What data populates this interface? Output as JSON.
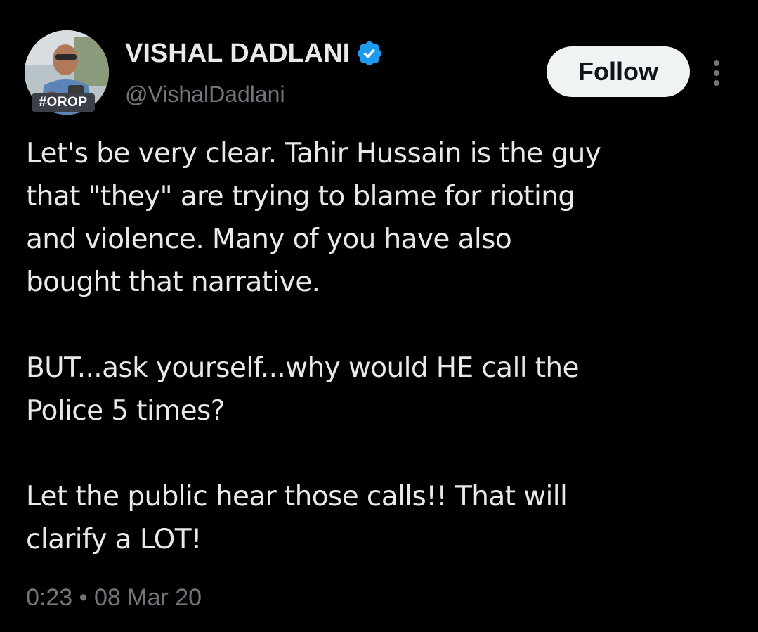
{
  "author": {
    "display_name": "VISHAL DADLANI",
    "handle": "@VishalDadlani",
    "verified": true,
    "avatar_badge": "#OROP"
  },
  "actions": {
    "follow_label": "Follow",
    "more_icon": "more-vertical-icon"
  },
  "tweet": {
    "paragraphs": [
      "Let's be very clear. Tahir Hussain is the guy\nthat \"they\" are trying to blame for rioting\nand violence. Many of you have also\nbought that narrative.",
      "BUT...ask yourself...why would HE call the\nPolice 5 times?",
      "Let the public hear those calls!! That will\nclarify a LOT!"
    ],
    "time": "0:23",
    "separator": "•",
    "date": "08 Mar 20"
  },
  "colors": {
    "background": "#000000",
    "primary_text": "#e7e9ea",
    "secondary_text": "#71767b",
    "verified_blue": "#1d9bf0",
    "follow_bg": "#eff3f4"
  }
}
